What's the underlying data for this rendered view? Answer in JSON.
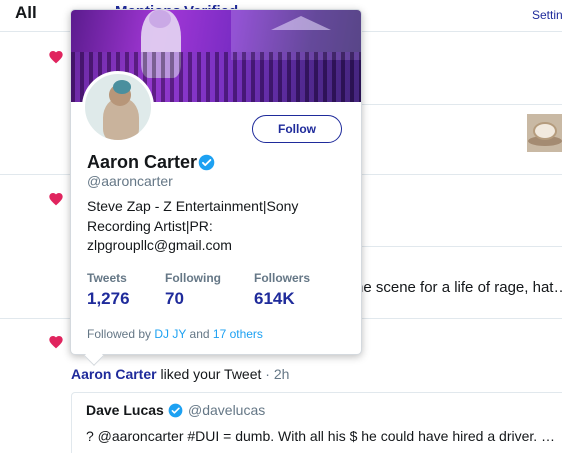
{
  "tabs": {
    "all": "All",
    "mentions": "Mentions",
    "verified": "Verified",
    "settings": "Settings"
  },
  "timeline": {
    "background_snippet": "ne scene for a life of rage, hat…",
    "liked_row": {
      "liker_name": "Aaron Carter",
      "action": "liked your Tweet",
      "separator": "·",
      "time": "2h"
    },
    "quoted_tweet": {
      "author_name": "Dave Lucas",
      "author_handle": "@davelucas",
      "text": "? @aaroncarter #DUI = dumb. With all his $ he could have hired a driver. …"
    }
  },
  "profile_card": {
    "follow_label": "Follow",
    "name": "Aaron Carter",
    "handle": "@aaroncarter",
    "bio": "Steve Zap - Z Entertainment|Sony Recording Artist|PR: zlpgroupllc@gmail.com",
    "stats": [
      {
        "label": "Tweets",
        "value": "1,276"
      },
      {
        "label": "Following",
        "value": "70"
      },
      {
        "label": "Followers",
        "value": "614K"
      }
    ],
    "followed_by": {
      "prefix": "Followed by",
      "first": "DJ JY",
      "conjunction": "and",
      "others": "17 others"
    }
  },
  "colors": {
    "link_blue": "#1f2b9b",
    "like_red": "#e0245e",
    "verified_blue": "#1da1f2",
    "muted_gray": "#657786"
  },
  "icons": {
    "like": "heart-icon",
    "verified": "verified-badge-icon"
  }
}
